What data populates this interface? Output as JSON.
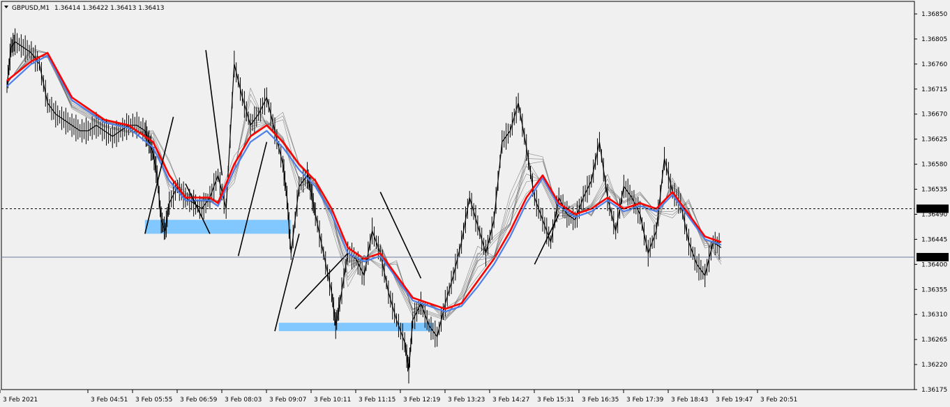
{
  "header": {
    "symbol": "GBPUSD,M1",
    "ohlc": "1.36414 1.36422 1.36413 1.36413",
    "menu_icon": "triangle-down-icon"
  },
  "chart_data": {
    "type": "candlestick",
    "symbol": "GBPUSD",
    "timeframe": "M1",
    "ylim": [
      1.36175,
      1.3685
    ],
    "y_ticks": [
      "1.36850",
      "1.36805",
      "1.36760",
      "1.36715",
      "1.36670",
      "1.36625",
      "1.36580",
      "1.36535",
      "1.36490",
      "1.36445",
      "1.36400",
      "1.36355",
      "1.36310",
      "1.36265",
      "1.36220",
      "1.36175"
    ],
    "x_ticks": [
      "3 Feb 2021",
      "3 Feb 04:51",
      "3 Feb 05:55",
      "3 Feb 06:59",
      "3 Feb 08:03",
      "3 Feb 09:07",
      "3 Feb 10:11",
      "3 Feb 11:15",
      "3 Feb 12:19",
      "3 Feb 13:23",
      "3 Feb 14:27",
      "3 Feb 15:31",
      "3 Feb 16:35",
      "3 Feb 17:39",
      "3 Feb 18:43",
      "3 Feb 19:47",
      "3 Feb 20:51"
    ],
    "horizontal_levels": [
      {
        "label": "1.36500",
        "price": 1.365,
        "style": "dashed"
      },
      {
        "label": "1.36413",
        "price": 1.36413,
        "style": "bid"
      }
    ],
    "price_path": [
      [
        0,
        1.3672
      ],
      [
        0.5,
        1.3679
      ],
      [
        1,
        1.368
      ],
      [
        2,
        1.3679
      ],
      [
        3,
        1.3678
      ],
      [
        4,
        1.3676
      ],
      [
        5,
        1.3669
      ],
      [
        6,
        1.3667
      ],
      [
        7,
        1.3666
      ],
      [
        8,
        1.3665
      ],
      [
        9,
        1.3664
      ],
      [
        10,
        1.3664
      ],
      [
        11,
        1.3665
      ],
      [
        12,
        1.3664
      ],
      [
        13,
        1.3663
      ],
      [
        14,
        1.3664
      ],
      [
        15,
        1.3665
      ],
      [
        16,
        1.3665
      ],
      [
        17,
        1.3664
      ],
      [
        17.5,
        1.3662
      ],
      [
        18,
        1.366
      ],
      [
        18.5,
        1.3656
      ],
      [
        19,
        1.3648
      ],
      [
        19.5,
        1.3646
      ],
      [
        20,
        1.3651
      ],
      [
        21,
        1.3654
      ],
      [
        22,
        1.3652
      ],
      [
        23,
        1.3651
      ],
      [
        24,
        1.365
      ],
      [
        25,
        1.3652
      ],
      [
        26,
        1.3656
      ],
      [
        27,
        1.365
      ],
      [
        28,
        1.3676
      ],
      [
        29,
        1.367
      ],
      [
        30,
        1.3665
      ],
      [
        31,
        1.3667
      ],
      [
        32,
        1.367
      ],
      [
        33,
        1.3664
      ],
      [
        34,
        1.3658
      ],
      [
        34.5,
        1.3652
      ],
      [
        35,
        1.3642
      ],
      [
        36,
        1.3654
      ],
      [
        37,
        1.3656
      ],
      [
        37.5,
        1.3653
      ],
      [
        38,
        1.3649
      ],
      [
        39,
        1.3642
      ],
      [
        40,
        1.3635
      ],
      [
        40.5,
        1.3629
      ],
      [
        41,
        1.3633
      ],
      [
        42,
        1.3642
      ],
      [
        43,
        1.3641
      ],
      [
        44,
        1.3638
      ],
      [
        45,
        1.3646
      ],
      [
        46,
        1.3642
      ],
      [
        47,
        1.3635
      ],
      [
        48,
        1.363
      ],
      [
        49,
        1.3626
      ],
      [
        49.5,
        1.3621
      ],
      [
        50,
        1.363
      ],
      [
        51,
        1.3633
      ],
      [
        52,
        1.3629
      ],
      [
        53,
        1.3627
      ],
      [
        54,
        1.3633
      ],
      [
        55,
        1.3638
      ],
      [
        56,
        1.3644
      ],
      [
        57,
        1.3652
      ],
      [
        58,
        1.3647
      ],
      [
        59,
        1.3642
      ],
      [
        60,
        1.3648
      ],
      [
        61,
        1.3662
      ],
      [
        62,
        1.3664
      ],
      [
        63,
        1.3669
      ],
      [
        64,
        1.3661
      ],
      [
        65,
        1.3652
      ],
      [
        66,
        1.3648
      ],
      [
        67,
        1.3644
      ],
      [
        68,
        1.3652
      ],
      [
        69,
        1.3649
      ],
      [
        70,
        1.3648
      ],
      [
        71,
        1.3652
      ],
      [
        72,
        1.3655
      ],
      [
        73,
        1.3662
      ],
      [
        74,
        1.3652
      ],
      [
        75,
        1.3646
      ],
      [
        76,
        1.3654
      ],
      [
        77,
        1.3652
      ],
      [
        78,
        1.3649
      ],
      [
        79,
        1.3642
      ],
      [
        80,
        1.3646
      ],
      [
        81,
        1.3659
      ],
      [
        82,
        1.3653
      ],
      [
        83,
        1.3651
      ],
      [
        84,
        1.3644
      ],
      [
        85,
        1.364
      ],
      [
        86,
        1.3638
      ],
      [
        87,
        1.3644
      ],
      [
        88,
        1.3643
      ]
    ],
    "moving_averages": [
      {
        "name": "",
        "color": "#ff0000",
        "path": [
          [
            0,
            1.3673
          ],
          [
            3,
            1.36765
          ],
          [
            5,
            1.3678
          ],
          [
            8,
            1.367
          ],
          [
            12,
            1.3666
          ],
          [
            15,
            1.3665
          ],
          [
            18,
            1.3662
          ],
          [
            20,
            1.3656
          ],
          [
            22,
            1.3652
          ],
          [
            25,
            1.3652
          ],
          [
            26,
            1.3651
          ],
          [
            28,
            1.3658
          ],
          [
            30,
            1.3663
          ],
          [
            32,
            1.3665
          ],
          [
            34,
            1.3662
          ],
          [
            36,
            1.3658
          ],
          [
            38,
            1.3655
          ],
          [
            40,
            1.365
          ],
          [
            42,
            1.3643
          ],
          [
            44,
            1.3641
          ],
          [
            46,
            1.3642
          ],
          [
            48,
            1.3638
          ],
          [
            50,
            1.3634
          ],
          [
            52,
            1.3633
          ],
          [
            54,
            1.3632
          ],
          [
            56,
            1.3633
          ],
          [
            58,
            1.3637
          ],
          [
            60,
            1.3641
          ],
          [
            62,
            1.3646
          ],
          [
            64,
            1.3652
          ],
          [
            66,
            1.3656
          ],
          [
            68,
            1.3651
          ],
          [
            70,
            1.3649
          ],
          [
            72,
            1.365
          ],
          [
            74,
            1.3652
          ],
          [
            76,
            1.365
          ],
          [
            78,
            1.3651
          ],
          [
            80,
            1.365
          ],
          [
            82,
            1.3653
          ],
          [
            84,
            1.3649
          ],
          [
            86,
            1.3645
          ],
          [
            88,
            1.3644
          ]
        ]
      },
      {
        "name": "",
        "color": "#4f7fe8",
        "path": [
          [
            0,
            1.3672
          ],
          [
            3,
            1.3676
          ],
          [
            5,
            1.36775
          ],
          [
            8,
            1.36695
          ],
          [
            12,
            1.36655
          ],
          [
            15,
            1.36645
          ],
          [
            18,
            1.3661
          ],
          [
            20,
            1.3655
          ],
          [
            22,
            1.36515
          ],
          [
            25,
            1.36515
          ],
          [
            26,
            1.36505
          ],
          [
            28,
            1.3657
          ],
          [
            30,
            1.3662
          ],
          [
            32,
            1.3664
          ],
          [
            34,
            1.3661
          ],
          [
            36,
            1.3657
          ],
          [
            38,
            1.3654
          ],
          [
            40,
            1.3649
          ],
          [
            42,
            1.3642
          ],
          [
            44,
            1.36405
          ],
          [
            46,
            1.36415
          ],
          [
            48,
            1.36375
          ],
          [
            50,
            1.36335
          ],
          [
            52,
            1.36325
          ],
          [
            54,
            1.36315
          ],
          [
            56,
            1.36325
          ],
          [
            58,
            1.3636
          ],
          [
            60,
            1.364
          ],
          [
            62,
            1.3645
          ],
          [
            64,
            1.3651
          ],
          [
            66,
            1.36555
          ],
          [
            68,
            1.36505
          ],
          [
            70,
            1.36485
          ],
          [
            72,
            1.36495
          ],
          [
            74,
            1.36515
          ],
          [
            76,
            1.36495
          ],
          [
            78,
            1.36505
          ],
          [
            80,
            1.36495
          ],
          [
            82,
            1.36525
          ],
          [
            84,
            1.36485
          ],
          [
            86,
            1.36445
          ],
          [
            88,
            1.36435
          ]
        ]
      }
    ],
    "trendlines": [
      {
        "from": [
          17,
          1.36455
        ],
        "to": [
          20.5,
          1.36665
        ]
      },
      {
        "from": [
          22,
          1.36545
        ],
        "to": [
          25,
          1.36455
        ]
      },
      {
        "from": [
          24.5,
          1.36785
        ],
        "to": [
          26.5,
          1.3656
        ]
      },
      {
        "from": [
          28.5,
          1.36415
        ],
        "to": [
          32,
          1.3662
        ]
      },
      {
        "from": [
          33,
          1.3628
        ],
        "to": [
          36,
          1.36455
        ]
      },
      {
        "from": [
          35.5,
          1.3632
        ],
        "to": [
          42,
          1.3642
        ]
      },
      {
        "from": [
          46,
          1.3653
        ],
        "to": [
          51,
          1.36375
        ]
      },
      {
        "from": [
          65,
          1.364
        ],
        "to": [
          68,
          1.3649
        ]
      }
    ],
    "zones": [
      {
        "from": [
          17,
          1.3648
        ],
        "to": [
          35,
          1.36455
        ],
        "color": "#80c8ff"
      },
      {
        "from": [
          33.5,
          1.36295
        ],
        "to": [
          52.5,
          1.3628
        ],
        "color": "#80c8ff"
      }
    ]
  }
}
